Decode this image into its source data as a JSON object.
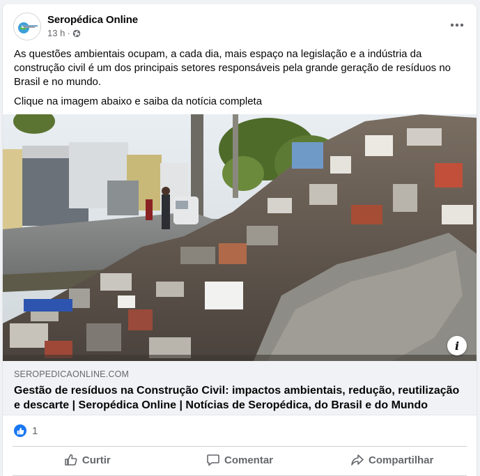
{
  "post": {
    "author": "Seropédica Online",
    "avatar_text": "Seropédica Online",
    "time": "13 h",
    "separator": "·",
    "privacy_icon": "globe-icon",
    "menu_icon": "more-horizontal-icon",
    "caption": {
      "paragraph1": "As questões ambientais ocupam, a cada dia, mais espaço na legislação e a indústria da construção civil é um dos principais setores responsáveis pela grande geração de resíduos no Brasil e no mundo.",
      "paragraph2": "Clique na imagem abaixo e saiba da notícia completa"
    }
  },
  "link_preview": {
    "image_description_icon": "construction-debris-photo",
    "info_label": "i",
    "domain": "SEROPEDICAONLINE.COM",
    "title": "Gestão de resíduos na Construção Civil: impactos ambientais, redução, reutilização e descarte | Seropédica Online | Notícias de Seropédica, do Brasil e do Mundo"
  },
  "reactions": {
    "icon": "like-reaction-icon",
    "count": "1"
  },
  "actions": {
    "like": "Curtir",
    "comment": "Comentar",
    "share": "Compartilhar"
  },
  "colors": {
    "background": "#f0f2f5",
    "card": "#ffffff",
    "text_primary": "#050505",
    "text_secondary": "#65676b",
    "link_box": "#f0f2f5",
    "like_blue": "#1877f2"
  }
}
